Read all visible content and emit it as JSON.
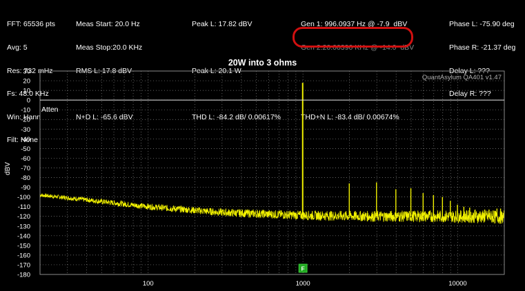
{
  "header": {
    "col1": [
      "FFT: 65536 pts",
      "Avg: 5",
      "Res: 732 mHz",
      "Fs: 48.0 KHz",
      "Win: Hann",
      "Filt: None"
    ],
    "col2": [
      "Meas Start: 20.0 Hz",
      "Meas Stop:20.0 KHz",
      "RMS L: 17.8 dBV",
      "",
      "N+D L: -65.6 dBV"
    ],
    "col3": [
      "Peak L: 17.82 dBV",
      "",
      "Peak L: 20.1 W",
      "",
      "THD L: -84.2 dB/ 0.00617%"
    ],
    "col4": [
      "Gen 1: 996.0937 Hz @ -7.9  dBV",
      "Gen 2:20.00390 KHz @ -14.0  dBV",
      "",
      "",
      "THD+N L: -83.4 dB/ 0.00674%"
    ],
    "col5": [
      "Phase L: -75.90 deg",
      "Phase R: -21.37 deg",
      "Delay L: ???",
      "Delay R: ???"
    ]
  },
  "chart_data": {
    "type": "line",
    "title": "20W into 3 ohms",
    "watermark": "QuantAsylum QA401 v1.47",
    "ylabel": "dBV",
    "ylim": [
      -180,
      30
    ],
    "yticks": [
      30,
      20,
      10,
      0,
      -10,
      -20,
      -30,
      -40,
      -50,
      -60,
      -70,
      -80,
      -90,
      -100,
      -110,
      -120,
      -130,
      -140,
      -150,
      -160,
      -170,
      -180
    ],
    "x_scale": "log",
    "xlim": [
      20,
      20000
    ],
    "xticks": [
      100,
      1000,
      10000
    ],
    "grid": true,
    "atten_label": "Atten",
    "atten_level": 0,
    "marker_label": "F",
    "marker_x": 1000,
    "noise_floor": [
      [
        20,
        -98
      ],
      [
        40,
        -103
      ],
      [
        100,
        -110
      ],
      [
        300,
        -116
      ],
      [
        1000,
        -119
      ],
      [
        3000,
        -120
      ],
      [
        10000,
        -120
      ],
      [
        20000,
        -121
      ]
    ],
    "series": [
      {
        "color": "#f2f200",
        "peaks": [
          [
            996,
            17.8
          ],
          [
            1992,
            -86
          ],
          [
            2988,
            -85
          ],
          [
            3984,
            -92
          ],
          [
            4980,
            -91
          ],
          [
            5976,
            -96
          ],
          [
            6972,
            -98
          ],
          [
            7968,
            -100
          ],
          [
            8964,
            -104
          ],
          [
            9960,
            -108
          ],
          [
            10956,
            -110
          ],
          [
            11952,
            -111
          ],
          [
            12948,
            -113
          ],
          [
            13944,
            -115
          ],
          [
            14940,
            -113
          ],
          [
            15936,
            -113
          ],
          [
            16932,
            -114
          ],
          [
            17928,
            -112
          ],
          [
            18924,
            -112
          ]
        ]
      }
    ],
    "colors": {
      "background": "#000000",
      "grid": "#8a8a8a",
      "trace": "#f2f200",
      "marker": "#22aa22",
      "highlight": "#d01010"
    }
  }
}
